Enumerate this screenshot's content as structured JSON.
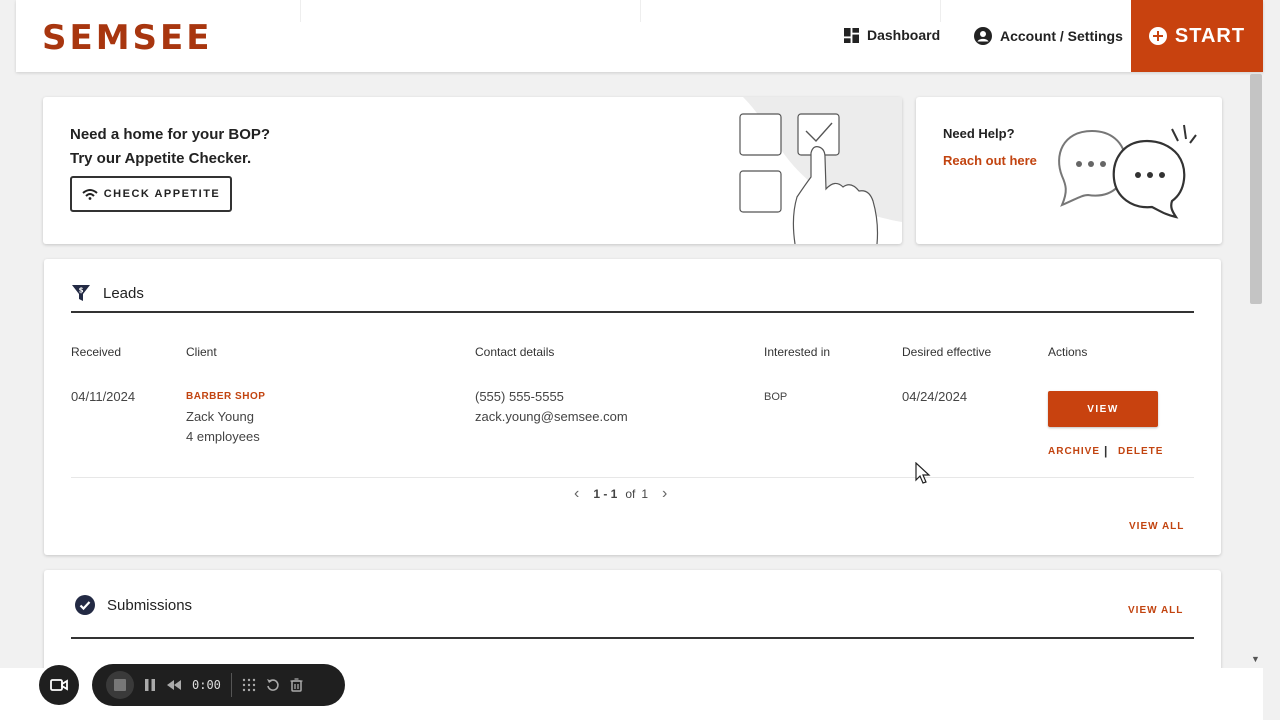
{
  "header": {
    "logo": "SEMSEE",
    "nav": [
      {
        "label": "Dashboard",
        "icon": "dashboard-grid-icon"
      },
      {
        "label": "Account / Settings",
        "icon": "account-circle-icon"
      }
    ],
    "start_label": "START"
  },
  "promo": {
    "line1": "Need a home for your BOP?",
    "line2": "Try our Appetite Checker.",
    "button_label": "CHECK APPETITE"
  },
  "help": {
    "title": "Need Help?",
    "link": "Reach out here"
  },
  "leads": {
    "title": "Leads",
    "columns": [
      "Received",
      "Client",
      "Contact details",
      "Interested in",
      "Desired effective",
      "Actions"
    ],
    "rows": [
      {
        "received": "04/11/2024",
        "client_tag": "BARBER SHOP",
        "client_name": "Zack Young",
        "client_size": "4 employees",
        "phone": "(555) 555-5555",
        "email": "zack.young@semsee.com",
        "interested_in": "BOP",
        "desired_effective": "04/24/2024",
        "view_label": "VIEW",
        "archive_label": "ARCHIVE",
        "separator": "|",
        "delete_label": "DELETE"
      }
    ],
    "pagination": {
      "range": "1 - 1",
      "of_label": "of",
      "total": "1"
    },
    "view_all": "VIEW ALL"
  },
  "submissions": {
    "title": "Submissions",
    "view_all": "VIEW ALL"
  },
  "recorder": {
    "time": "0:00"
  },
  "colors": {
    "brand": "#c8420f",
    "brand_text": "#c24410",
    "logo": "#a8360f"
  }
}
